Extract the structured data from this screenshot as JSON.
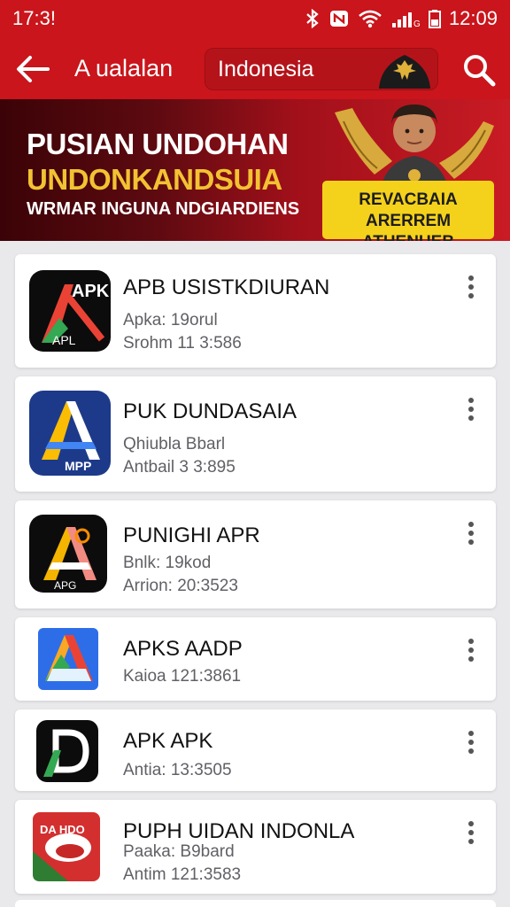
{
  "status": {
    "time_left": "17:3!",
    "time_right": "12:09",
    "icons": [
      "bluetooth-icon",
      "nfc-icon",
      "wifi-icon",
      "signal-icon",
      "battery-icon"
    ]
  },
  "appbar": {
    "title": "A ualalan",
    "search_value": "Indonesia",
    "icons": [
      "back-arrow-icon",
      "emblem-icon",
      "search-icon"
    ]
  },
  "banner": {
    "line1": "PUSIAN UNDOHAN",
    "line2": "UNDONKANDSUIA",
    "line3": "WRMAR INGUNA NDGIARDIENS",
    "cta_line1": "REVACBAIA",
    "cta_line2": "ARERREM ATHENUEB"
  },
  "apps": [
    {
      "name": "APB USISTKDIURAN",
      "meta1": "Apka: 19orul",
      "meta2": "Srohm 11 3:586",
      "icon": "apk-icon-red-green"
    },
    {
      "name": "PUK DUNDASAIA",
      "meta1": "Qhiubla Bbarl",
      "meta2": "Antbail 3 3:895",
      "icon": "apk-icon-blue-yellow"
    },
    {
      "name": "PUNIGHI APR",
      "meta1": "Bnlk: 19kod",
      "meta2": "Arrion: 20:3523",
      "icon": "apk-icon-black-orange"
    },
    {
      "name": "APKS AADP",
      "meta1": "Kaioa 121:3861",
      "meta2": "",
      "icon": "apk-icon-green-blue"
    },
    {
      "name": "APK APK",
      "meta1": "Antia: 13:3505",
      "meta2": "",
      "icon": "apk-icon-black-d"
    },
    {
      "name": "PUPH UIDAN INDONLA",
      "meta1": "Paaka: B9bard",
      "meta2": "Antim 121:3583",
      "icon": "apk-icon-red-white"
    }
  ],
  "colors": {
    "brand_red": "#c9151b",
    "accent_yellow": "#f4d21b",
    "banner_gold": "#f3c232"
  }
}
